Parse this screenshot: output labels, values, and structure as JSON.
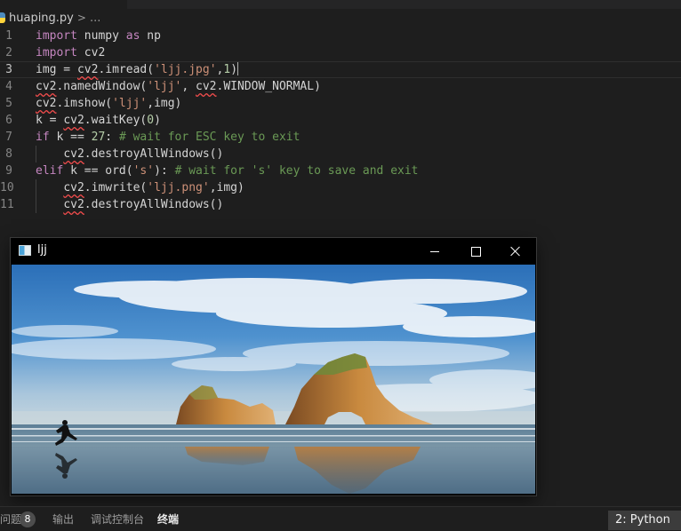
{
  "editor": {
    "breadcrumb": {
      "file": "huaping.py",
      "separator": ">",
      "more": "..."
    },
    "current_line": 3,
    "lines": [
      {
        "number": "1",
        "tokens": [
          {
            "t": "import",
            "c": "kw"
          },
          {
            "t": " numpy ",
            "c": "name"
          },
          {
            "t": "as",
            "c": "kw"
          },
          {
            "t": " np",
            "c": "name"
          }
        ]
      },
      {
        "number": "2",
        "tokens": [
          {
            "t": "import",
            "c": "kw"
          },
          {
            "t": " cv2",
            "c": "name"
          }
        ]
      },
      {
        "number": "3",
        "tokens": [
          {
            "t": "img = ",
            "c": "name"
          },
          {
            "t": "cv2",
            "c": "name",
            "squiggle": true
          },
          {
            "t": ".imread(",
            "c": "name"
          },
          {
            "t": "'ljj.jpg'",
            "c": "str"
          },
          {
            "t": ",",
            "c": "name"
          },
          {
            "t": "1",
            "c": "num"
          },
          {
            "t": ")",
            "c": "name"
          }
        ]
      },
      {
        "number": "4",
        "tokens": [
          {
            "t": "cv2",
            "c": "name",
            "squiggle": true
          },
          {
            "t": ".namedWindow(",
            "c": "name"
          },
          {
            "t": "'ljj'",
            "c": "str"
          },
          {
            "t": ", ",
            "c": "name"
          },
          {
            "t": "cv2",
            "c": "name",
            "squiggle": true
          },
          {
            "t": ".WINDOW_NORMAL)",
            "c": "name"
          }
        ]
      },
      {
        "number": "5",
        "tokens": [
          {
            "t": "cv2",
            "c": "name",
            "squiggle": true
          },
          {
            "t": ".imshow(",
            "c": "name"
          },
          {
            "t": "'ljj'",
            "c": "str"
          },
          {
            "t": ",img)",
            "c": "name"
          }
        ]
      },
      {
        "number": "6",
        "tokens": [
          {
            "t": "k = ",
            "c": "name"
          },
          {
            "t": "cv2",
            "c": "name",
            "squiggle": true
          },
          {
            "t": ".waitKey(",
            "c": "name"
          },
          {
            "t": "0",
            "c": "num"
          },
          {
            "t": ")",
            "c": "name"
          }
        ]
      },
      {
        "number": "7",
        "tokens": [
          {
            "t": "if",
            "c": "kw"
          },
          {
            "t": " k == ",
            "c": "name"
          },
          {
            "t": "27",
            "c": "num"
          },
          {
            "t": ": ",
            "c": "name"
          },
          {
            "t": "# wait for ESC key to exit",
            "c": "cmt"
          }
        ]
      },
      {
        "number": "8",
        "indent": true,
        "tokens": [
          {
            "t": "    ",
            "c": "name"
          },
          {
            "t": "cv2",
            "c": "name",
            "squiggle": true
          },
          {
            "t": ".destroyAllWindows()",
            "c": "name"
          }
        ]
      },
      {
        "number": "9",
        "tokens": [
          {
            "t": "elif",
            "c": "kw"
          },
          {
            "t": " k == ",
            "c": "name"
          },
          {
            "t": "ord",
            "c": "name"
          },
          {
            "t": "(",
            "c": "name"
          },
          {
            "t": "'s'",
            "c": "str"
          },
          {
            "t": "): ",
            "c": "name"
          },
          {
            "t": "# wait for 's' key to save and exit",
            "c": "cmt"
          }
        ]
      },
      {
        "number": "10",
        "indent": true,
        "tokens": [
          {
            "t": "    ",
            "c": "name"
          },
          {
            "t": "cv2",
            "c": "name",
            "squiggle": true
          },
          {
            "t": ".imwrite(",
            "c": "name"
          },
          {
            "t": "'ljj.png'",
            "c": "str"
          },
          {
            "t": ",img)",
            "c": "name"
          }
        ]
      },
      {
        "number": "11",
        "indent": true,
        "tokens": [
          {
            "t": "    ",
            "c": "name"
          },
          {
            "t": "cv2",
            "c": "name",
            "squiggle": true
          },
          {
            "t": ".destroyAllWindows()",
            "c": "name"
          }
        ]
      }
    ]
  },
  "cv_window": {
    "title": "ljj",
    "buttons": {
      "minimize": "minimize",
      "maximize": "maximize",
      "close": "close"
    }
  },
  "panel": {
    "tabs": {
      "problems": "问题",
      "problems_count": "8",
      "output": "输出",
      "debug_console": "调试控制台",
      "terminal": "终端"
    },
    "terminal_selector": "2: Python"
  },
  "colors": {
    "editor_bg": "#1e1e1e",
    "keyword": "#c586c0",
    "string": "#ce9178",
    "number": "#b5cea8",
    "comment": "#6a9955",
    "squiggle": "#f14c4c"
  }
}
